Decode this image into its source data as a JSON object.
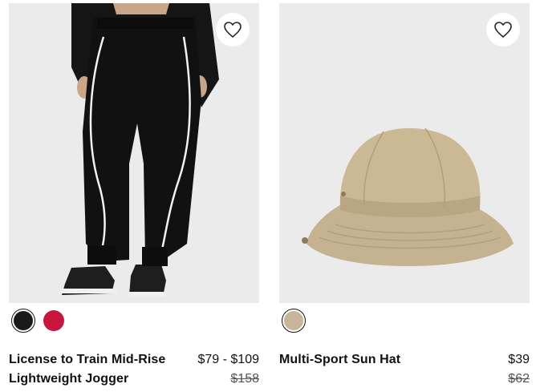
{
  "products": [
    {
      "name": "License to Train Mid-Rise Lightweight Jogger",
      "price": "$79 - $109",
      "original_price": "$158",
      "swatches": [
        {
          "color": "#1a1a1a",
          "selected": true
        },
        {
          "color": "#c8173f",
          "selected": false
        }
      ]
    },
    {
      "name": "Multi-Sport Sun Hat",
      "price": "$39",
      "original_price": "$62",
      "swatches": [
        {
          "color": "#c7b597",
          "selected": true
        }
      ]
    }
  ],
  "icons": {
    "wishlist": "heart-outline-icon"
  }
}
